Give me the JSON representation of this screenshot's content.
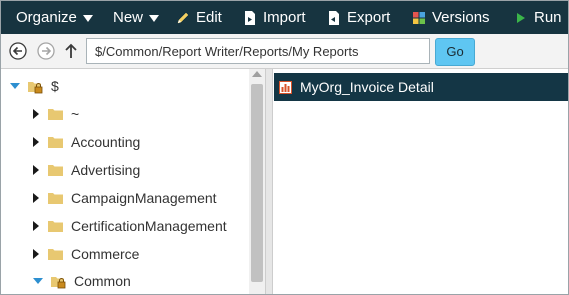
{
  "toolbar": {
    "organize": "Organize",
    "new": "New",
    "edit": "Edit",
    "import": "Import",
    "export": "Export",
    "versions": "Versions",
    "run": "Run"
  },
  "address_bar": {
    "path": "$/Common/Report Writer/Reports/My Reports",
    "go_label": "Go"
  },
  "tree": {
    "root": "$",
    "items": [
      "~",
      "Accounting",
      "Advertising",
      "CampaignManagement",
      "CertificationManagement",
      "Commerce",
      "Common"
    ]
  },
  "content": {
    "items": [
      {
        "label": "MyOrg_Invoice Detail"
      }
    ]
  },
  "colors": {
    "toolbar_bg": "#173440",
    "selected_row_bg": "#143645",
    "go_button": "#5fc6f2",
    "folder": "#e8c871",
    "expander_open": "#2d8fd0"
  }
}
